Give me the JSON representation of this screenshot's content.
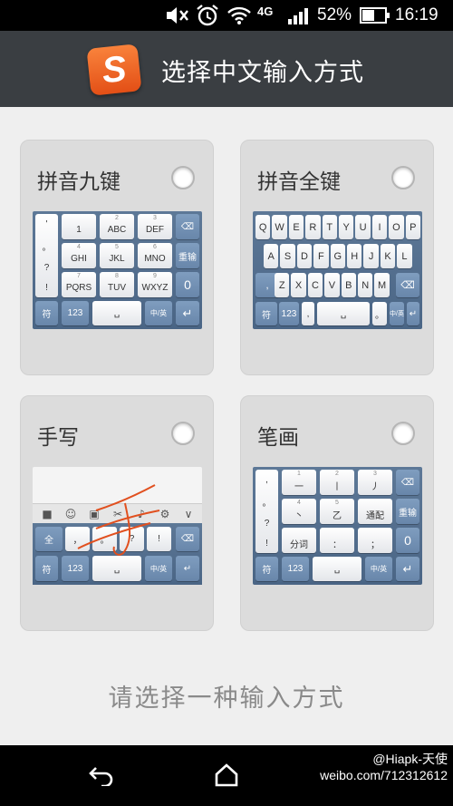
{
  "status_bar": {
    "battery": "52%",
    "time": "16:19",
    "network": "4G"
  },
  "header": {
    "title": "选择中文输入方式",
    "logo_letter": "S"
  },
  "options": [
    {
      "label": "拼音九键"
    },
    {
      "label": "拼音全键"
    },
    {
      "label": "手写"
    },
    {
      "label": "笔画"
    }
  ],
  "nine_key": {
    "side": [
      "'",
      "。",
      "?",
      "!"
    ],
    "rows": [
      [
        {
          "sub": "",
          "main": "1"
        },
        {
          "sub": "2",
          "main": "ABC"
        },
        {
          "sub": "3",
          "main": "DEF"
        }
      ],
      [
        {
          "sub": "4",
          "main": "GHI"
        },
        {
          "sub": "5",
          "main": "JKL"
        },
        {
          "sub": "6",
          "main": "MNO"
        }
      ],
      [
        {
          "sub": "7",
          "main": "PQRS"
        },
        {
          "sub": "8",
          "main": "TUV"
        },
        {
          "sub": "9",
          "main": "WXYZ"
        }
      ]
    ],
    "right": [
      "⌫",
      "重输",
      "0"
    ],
    "bottom": [
      "符",
      "123",
      "␣",
      "中/英",
      "↵"
    ]
  },
  "full_key": {
    "row1": [
      "Q",
      "W",
      "E",
      "R",
      "T",
      "Y",
      "U",
      "I",
      "O",
      "P"
    ],
    "row2": [
      "A",
      "S",
      "D",
      "F",
      "G",
      "H",
      "J",
      "K",
      "L"
    ],
    "row3": [
      ",",
      "Z",
      "X",
      "C",
      "V",
      "B",
      "N",
      "M",
      "⌫"
    ],
    "bottom": [
      "符",
      "123",
      ",",
      "␣",
      "。",
      "中/英",
      "↵"
    ]
  },
  "handwrite": {
    "toolbar": [
      "■",
      "☺",
      "▣",
      "✂",
      "♪",
      "⚙",
      "∨"
    ],
    "row": [
      "全",
      "，",
      "。",
      "?",
      "!",
      "⌫"
    ],
    "bottom": [
      "符",
      "123",
      "␣",
      "中/英",
      "↵"
    ]
  },
  "stroke": {
    "side": [
      ",",
      "。",
      "?",
      "!"
    ],
    "rows": [
      [
        {
          "sub": "1",
          "main": "一"
        },
        {
          "sub": "2",
          "main": "丨"
        },
        {
          "sub": "3",
          "main": "丿"
        }
      ],
      [
        {
          "sub": "4",
          "main": "丶"
        },
        {
          "sub": "5",
          "main": "乙"
        },
        {
          "sub": "",
          "main": "通配"
        }
      ],
      [
        {
          "sub": "",
          "main": "分词"
        },
        {
          "sub": "",
          "main": "："
        },
        {
          "sub": "",
          "main": "；"
        }
      ]
    ],
    "right": [
      "⌫",
      "重输",
      "0"
    ],
    "bottom": [
      "符",
      "123",
      "␣",
      "中/英",
      "↵"
    ]
  },
  "hint": "请选择一种输入方式",
  "watermark": {
    "line1": "@Hiapk-天使",
    "line2": "weibo.com/712312612"
  }
}
